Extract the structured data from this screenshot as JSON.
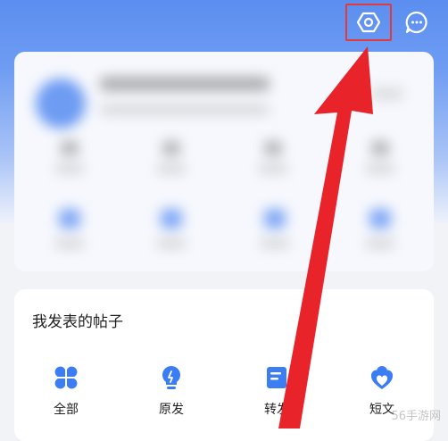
{
  "header": {
    "settings_icon": "hexagon-settings-icon",
    "message_icon": "chat-bubble-icon"
  },
  "posts_section": {
    "title": "我发表的帖子",
    "items": [
      {
        "label": "全部",
        "icon": "clover-grid-icon"
      },
      {
        "label": "原发",
        "icon": "lightbulb-icon"
      },
      {
        "label": "转发",
        "icon": "forward-doc-icon"
      },
      {
        "label": "短文",
        "icon": "heart-badge-icon"
      }
    ]
  },
  "watermark": "56手游网",
  "colors": {
    "header_blue": "#5b8ef0",
    "icon_blue": "#3d7df4",
    "highlight_red": "#e23a3a",
    "arrow_red": "#e8232a"
  }
}
